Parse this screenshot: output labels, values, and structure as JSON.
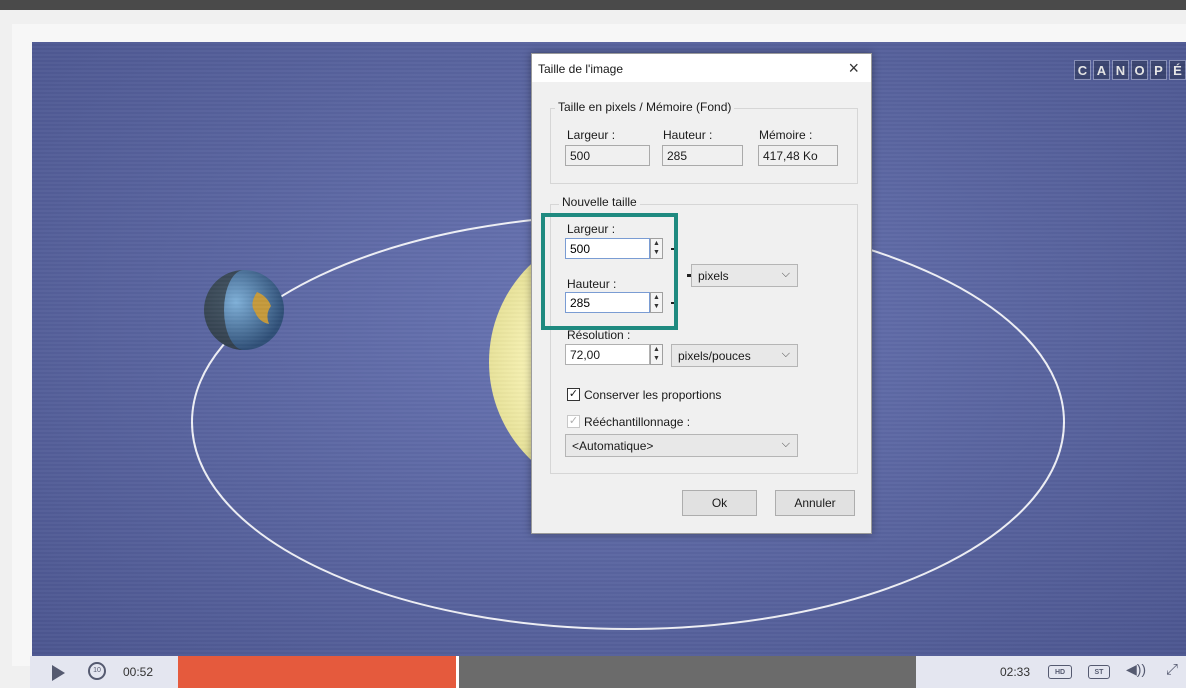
{
  "brand": {
    "logo_letters": [
      "C",
      "A",
      "N",
      "O",
      "P",
      "É"
    ]
  },
  "colors": {
    "stage": "#59649f",
    "highlight": "#1f8a80",
    "progress_played": "#e55a3d",
    "progress_rest": "#6b6b6b"
  },
  "dialog": {
    "title": "Taille de l'image",
    "close_glyph": "×",
    "current_group": {
      "label": "Taille en pixels / Mémoire (Fond)",
      "width_label": "Largeur :",
      "width_value": "500",
      "height_label": "Hauteur :",
      "height_value": "285",
      "memory_label": "Mémoire :",
      "memory_value": "417,48 Ko"
    },
    "new_group": {
      "label": "Nouvelle taille",
      "width_label": "Largeur :",
      "width_value": "500",
      "height_label": "Hauteur :",
      "height_value": "285",
      "unit_value": "pixels",
      "resolution_label": "Résolution :",
      "resolution_value": "72,00",
      "resolution_unit": "pixels/pouces",
      "keep_ratio_label": "Conserver les proportions",
      "keep_ratio_checked": true,
      "resample_label": "Rééchantillonnage :",
      "resample_checked": true,
      "resample_value": "<Automatique>"
    },
    "ok_label": "Ok",
    "cancel_label": "Annuler"
  },
  "player": {
    "current_time": "00:52",
    "duration": "02:33",
    "progress": 0.38,
    "hd_label": "HD",
    "subtitles_label": "ST",
    "play_icon": "play-icon",
    "replay_icon": "replay-10-icon",
    "replay_label": "10",
    "volume_icon": "volume-icon",
    "fullscreen_icon": "fullscreen-icon"
  }
}
